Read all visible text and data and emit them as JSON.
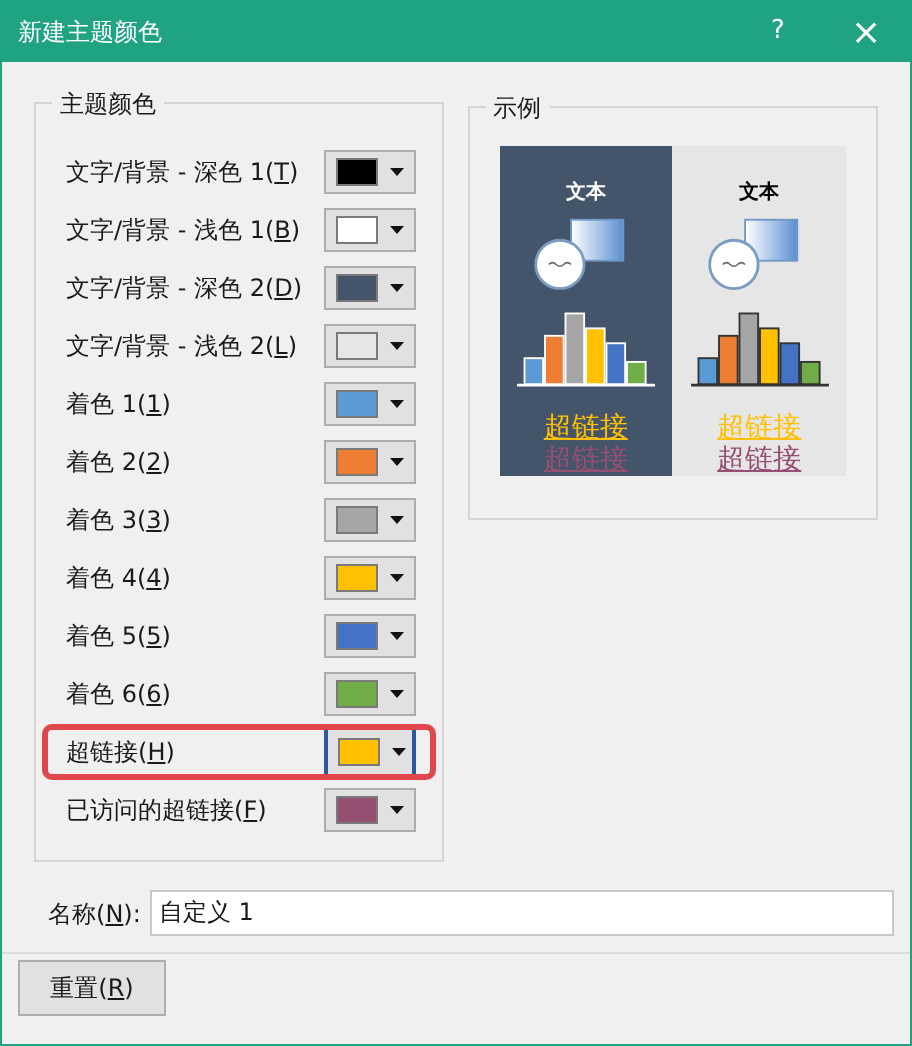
{
  "window": {
    "title": "新建主题颜色",
    "help_button": "?",
    "close_button": "×"
  },
  "theme_colors": {
    "title": "主题颜色",
    "rows": [
      {
        "before": "文字/背景 - 深色 1(",
        "mnemonic": "T",
        "after": ")",
        "color": "#000000",
        "highlighted": false
      },
      {
        "before": "文字/背景 - 浅色 1(",
        "mnemonic": "B",
        "after": ")",
        "color": "#ffffff",
        "highlighted": false
      },
      {
        "before": "文字/背景 - 深色 2(",
        "mnemonic": "D",
        "after": ")",
        "color": "#44546a",
        "highlighted": false
      },
      {
        "before": "文字/背景 - 浅色 2(",
        "mnemonic": "L",
        "after": ")",
        "color": "#e7e6e6",
        "highlighted": false
      },
      {
        "before": "着色 1(",
        "mnemonic": "1",
        "after": ")",
        "color": "#5b9bd5",
        "highlighted": false
      },
      {
        "before": "着色 2(",
        "mnemonic": "2",
        "after": ")",
        "color": "#ed7d31",
        "highlighted": false
      },
      {
        "before": "着色 3(",
        "mnemonic": "3",
        "after": ")",
        "color": "#a5a5a5",
        "highlighted": false
      },
      {
        "before": "着色 4(",
        "mnemonic": "4",
        "after": ")",
        "color": "#ffc000",
        "highlighted": false
      },
      {
        "before": "着色 5(",
        "mnemonic": "5",
        "after": ")",
        "color": "#4472c4",
        "highlighted": false
      },
      {
        "before": "着色 6(",
        "mnemonic": "6",
        "after": ")",
        "color": "#70ad47",
        "highlighted": false
      },
      {
        "before": "超链接(",
        "mnemonic": "H",
        "after": ")",
        "color": "#ffc000",
        "highlighted": true
      },
      {
        "before": "已访问的超链接(",
        "mnemonic": "F",
        "after": ")",
        "color": "#954f72",
        "highlighted": false
      }
    ]
  },
  "sample": {
    "title": "示例",
    "panels": [
      {
        "heading": "文本",
        "link": "超链接",
        "visited_link": "超链接"
      },
      {
        "heading": "文本",
        "link": "超链接",
        "visited_link": "超链接"
      }
    ]
  },
  "name_field": {
    "before": "名称(",
    "mnemonic": "N",
    "after": "):",
    "value": "自定义 1"
  },
  "reset_button": {
    "before": "重置(",
    "mnemonic": "R",
    "after": ")"
  }
}
